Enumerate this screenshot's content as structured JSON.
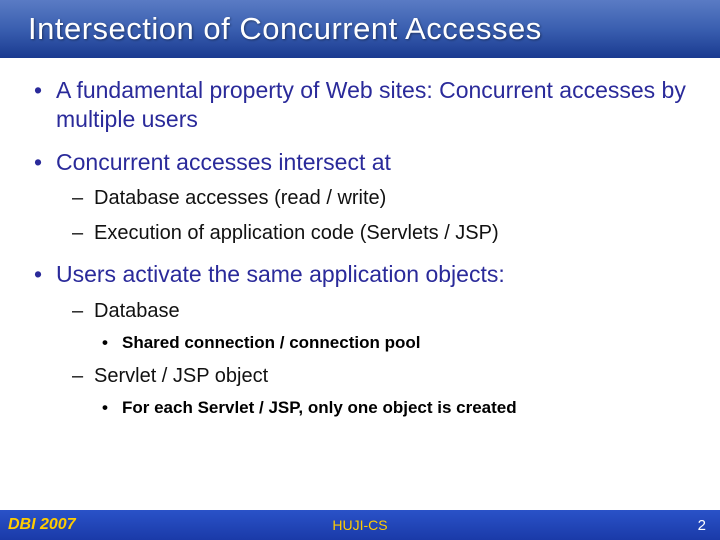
{
  "title": "Intersection of Concurrent Accesses",
  "bullets": [
    {
      "text": "A fundamental property of Web sites: Concurrent accesses by multiple users",
      "sub": []
    },
    {
      "text": "Concurrent accesses intersect at",
      "sub": [
        {
          "text": "Database accesses (read / write)",
          "subsub": []
        },
        {
          "text": "Execution of application code (Servlets / JSP)",
          "subsub": []
        }
      ]
    },
    {
      "text": "Users activate the same application objects:",
      "sub": [
        {
          "text": "Database",
          "subsub": [
            {
              "text": "Shared connection / connection pool"
            }
          ]
        },
        {
          "text": "Servlet / JSP object",
          "subsub": [
            {
              "text": "For each Servlet / JSP, only one object is created"
            }
          ]
        }
      ]
    }
  ],
  "footer": {
    "left": "DBI 2007",
    "center": "HUJI-CS",
    "right": "2"
  }
}
